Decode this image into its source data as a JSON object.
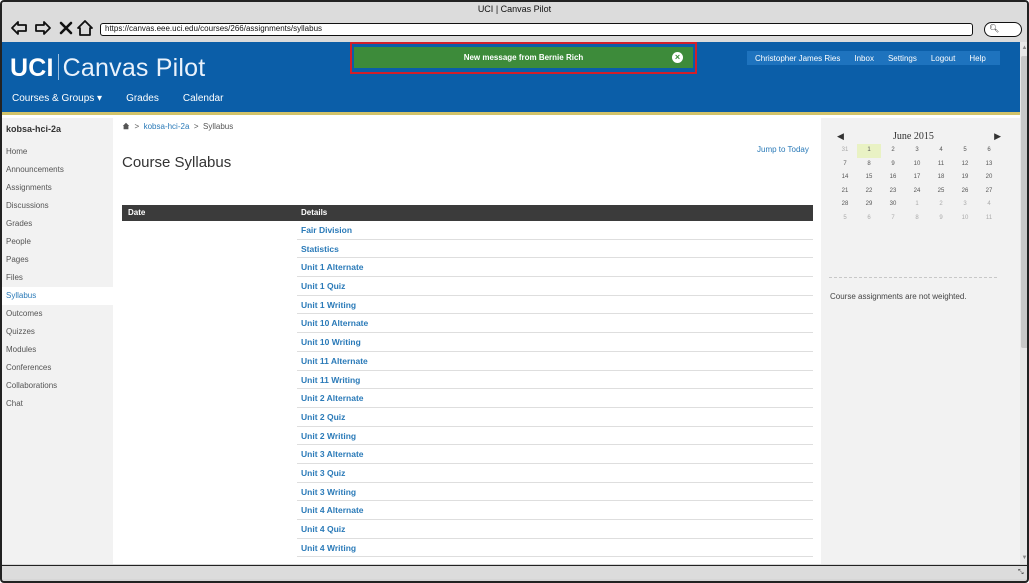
{
  "window": {
    "title": "UCI | Canvas Pilot",
    "url": "https://canvas.eee.uci.edu/courses/266/assignments/syllabus"
  },
  "header": {
    "logo_bold": "UCI",
    "logo_light": "Canvas Pilot",
    "nav": [
      "Courses & Groups ▾",
      "Grades",
      "Calendar"
    ],
    "user_links": [
      "Christopher James Ries",
      "Inbox",
      "Settings",
      "Logout",
      "Help"
    ],
    "brand_color": "#0b5ea8"
  },
  "notification": {
    "text": "New message from  Bernie Rich",
    "color": "#3d8b3a"
  },
  "sidebar": {
    "course": "kobsa-hci-2a",
    "items": [
      "Home",
      "Announcements",
      "Assignments",
      "Discussions",
      "Grades",
      "People",
      "Pages",
      "Files",
      "Syllabus",
      "Outcomes",
      "Quizzes",
      "Modules",
      "Conferences",
      "Collaborations",
      "Chat"
    ],
    "active": "Syllabus"
  },
  "breadcrumb": {
    "course": "kobsa-hci-2a",
    "page": "Syllabus"
  },
  "main": {
    "title": "Course Syllabus",
    "jump": "Jump to Today",
    "columns": [
      "Date",
      "Details"
    ],
    "assignments": [
      "Fair Division",
      "Statistics",
      "Unit 1 Alternate",
      "Unit 1 Quiz",
      "Unit 1 Writing",
      "Unit 10 Alternate",
      "Unit 10 Writing",
      "Unit 11 Alternate",
      "Unit 11 Writing",
      "Unit 2 Alternate",
      "Unit 2 Quiz",
      "Unit 2 Writing",
      "Unit 3 Alternate",
      "Unit 3 Quiz",
      "Unit 3 Writing",
      "Unit 4 Alternate",
      "Unit 4 Quiz",
      "Unit 4 Writing"
    ]
  },
  "calendar": {
    "month": "June 2015",
    "prev": "◀",
    "next": "▶",
    "days": [
      [
        "31",
        "1",
        "2",
        "3",
        "4",
        "5",
        "6"
      ],
      [
        "7",
        "8",
        "9",
        "10",
        "11",
        "12",
        "13"
      ],
      [
        "14",
        "15",
        "16",
        "17",
        "18",
        "19",
        "20"
      ],
      [
        "21",
        "22",
        "23",
        "24",
        "25",
        "26",
        "27"
      ],
      [
        "28",
        "29",
        "30",
        "1",
        "2",
        "3",
        "4"
      ],
      [
        "5",
        "6",
        "7",
        "8",
        "9",
        "10",
        "11"
      ]
    ],
    "today": "1"
  },
  "weighting_note": "Course assignments are not weighted."
}
